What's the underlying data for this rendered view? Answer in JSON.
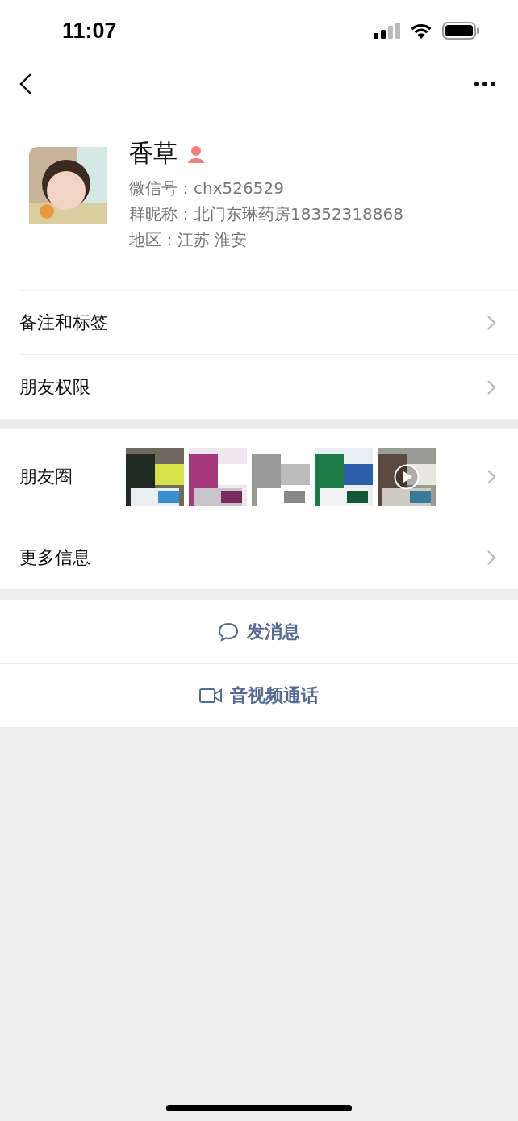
{
  "status_bar": {
    "time": "11:07"
  },
  "profile": {
    "name": "香草",
    "wechat_id": "微信号：chx526529",
    "group_nickname": "群昵称：北门东琳药房18352318868",
    "region": "地区：江苏 淮安"
  },
  "menu_top": [
    {
      "label": "备注和标签"
    },
    {
      "label": "朋友权限"
    }
  ],
  "moments": {
    "label": "朋友圈",
    "thumbnails": [
      {
        "kind": "picture"
      },
      {
        "kind": "picture"
      },
      {
        "kind": "picture"
      },
      {
        "kind": "picture"
      },
      {
        "kind": "video"
      }
    ]
  },
  "more_info": {
    "label": "更多信息"
  },
  "actions": [
    {
      "kind": "message",
      "label": "发消息"
    },
    {
      "kind": "call",
      "label": "音视频通话"
    }
  ]
}
